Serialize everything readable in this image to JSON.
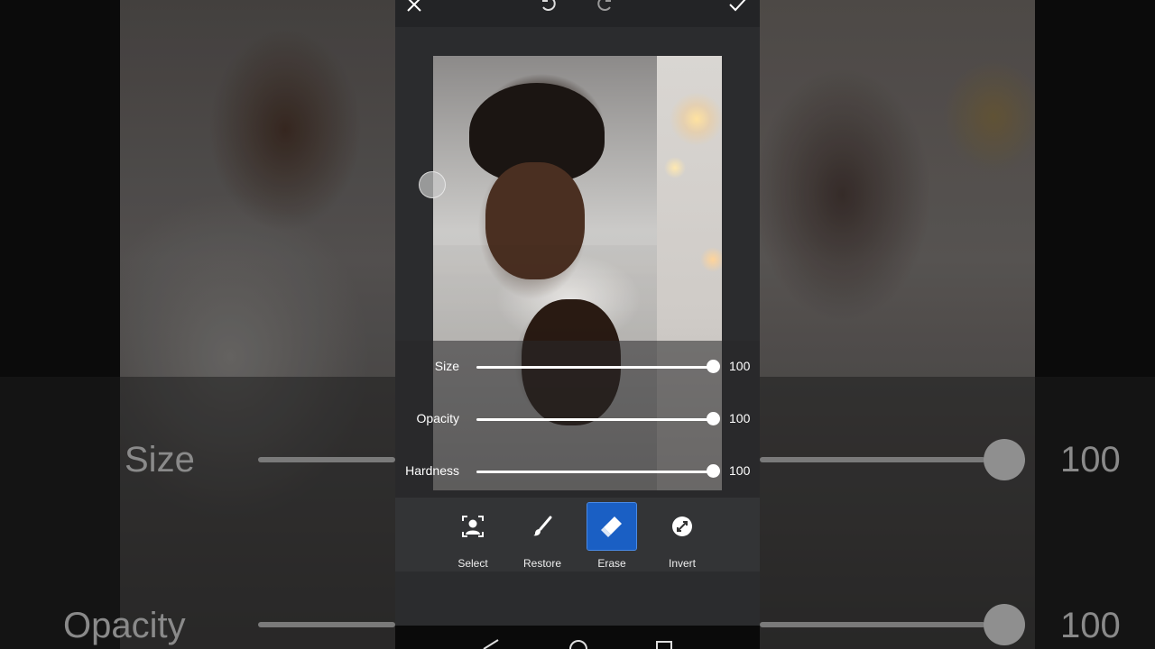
{
  "sliders": [
    {
      "label": "Size",
      "value": "100",
      "fraction": 1.0
    },
    {
      "label": "Opacity",
      "value": "100",
      "fraction": 1.0
    },
    {
      "label": "Hardness",
      "value": "100",
      "fraction": 1.0
    }
  ],
  "tools": [
    {
      "label": "Select",
      "icon": "select-person-icon",
      "active": false
    },
    {
      "label": "Restore",
      "icon": "brush-icon",
      "active": false
    },
    {
      "label": "Erase",
      "icon": "eraser-icon",
      "active": true
    },
    {
      "label": "Invert",
      "icon": "invert-icon",
      "active": false
    }
  ],
  "topbar": {
    "icons": [
      "close-icon",
      "undo-icon",
      "redo-icon",
      "check-icon"
    ]
  },
  "navbar": {
    "icons": [
      "back-icon",
      "home-icon",
      "recents-icon"
    ]
  },
  "backdrop": {
    "labels": [
      "Size",
      "Opacity"
    ],
    "values": [
      "100",
      "100"
    ]
  },
  "colors": {
    "accent": "#1a5fc4",
    "panel": "#333436"
  }
}
